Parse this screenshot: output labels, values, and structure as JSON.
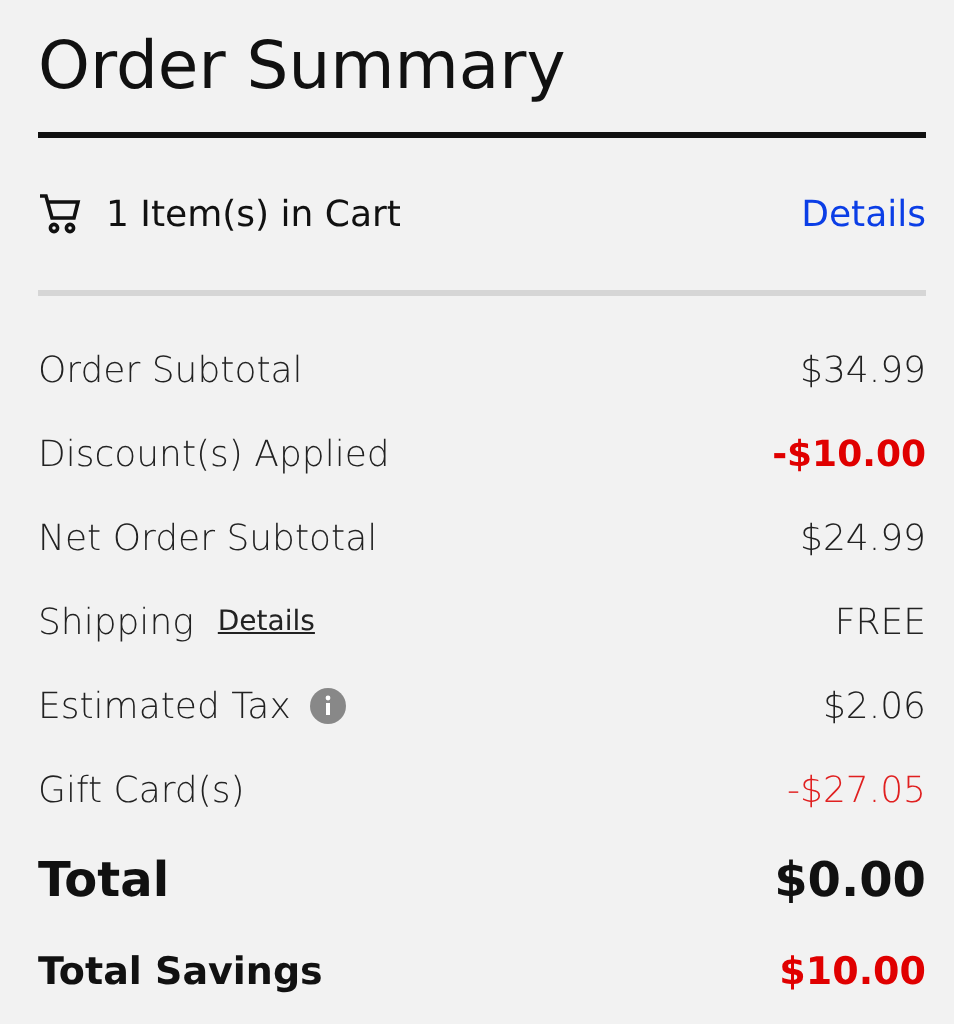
{
  "title": "Order Summary",
  "cart": {
    "label": "1 Item(s) in Cart",
    "link": "Details"
  },
  "lines": [
    {
      "kind": "plain",
      "label": "Order Subtotal",
      "value": "$34.99",
      "color": "#222222",
      "bold": false
    },
    {
      "kind": "plain",
      "label": "Discount(s) Applied",
      "value": "-$10.00",
      "color": "#e00000",
      "bold": true
    },
    {
      "kind": "plain",
      "label": "Net Order Subtotal",
      "value": "$24.99",
      "color": "#222222",
      "bold": false
    },
    {
      "kind": "link",
      "label": "Shipping",
      "link": "Details",
      "value": "FREE",
      "color": "#222222",
      "bold": false
    },
    {
      "kind": "info",
      "label": "Estimated Tax",
      "value": "$2.06",
      "color": "#222222",
      "bold": false
    },
    {
      "kind": "plain",
      "label": "Gift Card(s)",
      "value": "-$27.05",
      "color": "#e02020",
      "bold": false
    }
  ],
  "total": {
    "label": "Total",
    "value": "$0.00"
  },
  "savings": {
    "label": "Total Savings",
    "value": "$10.00"
  }
}
